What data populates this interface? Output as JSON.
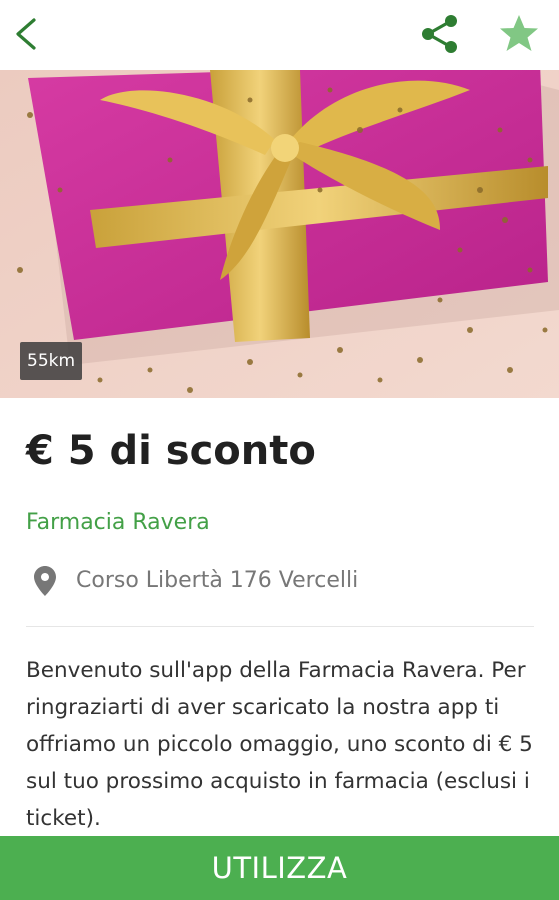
{
  "header": {
    "back_icon": "chevron-left-icon",
    "share_icon": "share-icon",
    "favorite_icon": "star-icon",
    "accent_color": "#2e7d32",
    "star_color": "#81c784"
  },
  "hero": {
    "image": "gift-box-with-gold-ribbon",
    "distance": "55km"
  },
  "offer": {
    "title": "€ 5 di sconto",
    "store": "Farmacia Ravera",
    "address_icon": "map-pin-icon",
    "address": "Corso Libertà 176 Vercelli",
    "description": "Benvenuto sull'app della Farmacia Ravera. Per ringraziarti di aver scaricato la nostra app ti offriamo un piccolo omaggio, uno sconto di € 5 sul tuo prossimo acquisto in farmacia (esclusi i ticket)."
  },
  "cta": {
    "label": "UTILIZZA",
    "color": "#4caf50"
  }
}
